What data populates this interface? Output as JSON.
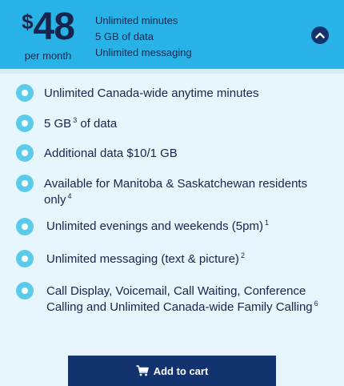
{
  "plan": {
    "currency_symbol": "$",
    "price": "48",
    "period": "per month",
    "summary": [
      "Unlimited minutes",
      "5 GB of data",
      "Unlimited messaging"
    ]
  },
  "toggle": {
    "icon": "chevron-up-icon",
    "state": "expanded"
  },
  "features": [
    {
      "text": "Unlimited Canada-wide anytime minutes",
      "sup": "",
      "after": ""
    },
    {
      "text": "5 GB",
      "sup": "3",
      "after": "of data"
    },
    {
      "text": "Additional data $10/1 GB",
      "sup": "",
      "after": ""
    },
    {
      "text": "Available for Manitoba & Saskatchewan residents only",
      "sup": "4",
      "after": ""
    },
    {
      "text": "Unlimited evenings and weekends (5pm)",
      "sup": "1",
      "after": ""
    },
    {
      "text": "Unlimited messaging (text & picture)",
      "sup": "2",
      "after": ""
    },
    {
      "text": "Call Display, Voicemail, Call Waiting, Conference Calling and Unlimited Canada-wide Family Calling",
      "sup": "6",
      "after": ""
    }
  ],
  "cart": {
    "label": "Add to cart",
    "icon": "cart-icon"
  },
  "colors": {
    "header_bg": "#29b2e6",
    "body_bg": "#e6f6fc",
    "text": "#17244d",
    "button_bg": "#12336e",
    "bullet": "#5ccbea"
  }
}
